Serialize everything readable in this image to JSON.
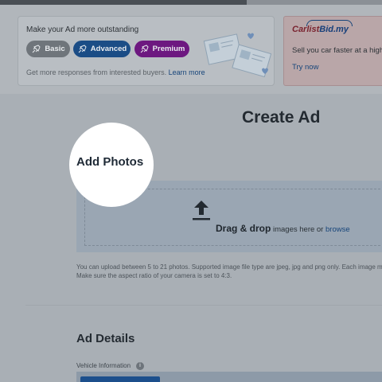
{
  "promo": {
    "title": "Make your Ad more outstanding",
    "tiers": [
      "Basic",
      "Advanced",
      "Premium"
    ],
    "subtitle": "Get more responses from interested buyers.",
    "learn_more": "Learn more"
  },
  "carlistbid": {
    "logo_main": "Carlist",
    "logo_bid": "Bid.my",
    "text": "Sell you car faster at a highe",
    "cta": "Try now"
  },
  "page": {
    "heading": "Create Ad"
  },
  "photos": {
    "title": "Add Photos",
    "drag_bold": "Drag & drop",
    "drag_rest": "images here or",
    "browse": "browse",
    "help_line1": "You can upload between 5 to 21 photos. Supported image file type are jpeg, jpg and png only. Each image mu",
    "help_line2": "Make sure the aspect ratio of your camera is set to 4:3."
  },
  "details": {
    "title": "Ad Details",
    "vehicle_label": "Vehicle Information",
    "info_glyph": "i"
  },
  "colors": {
    "accent": "#1a5fb4",
    "premium": "#7b1fa2",
    "carlistbid": "#c62828"
  }
}
